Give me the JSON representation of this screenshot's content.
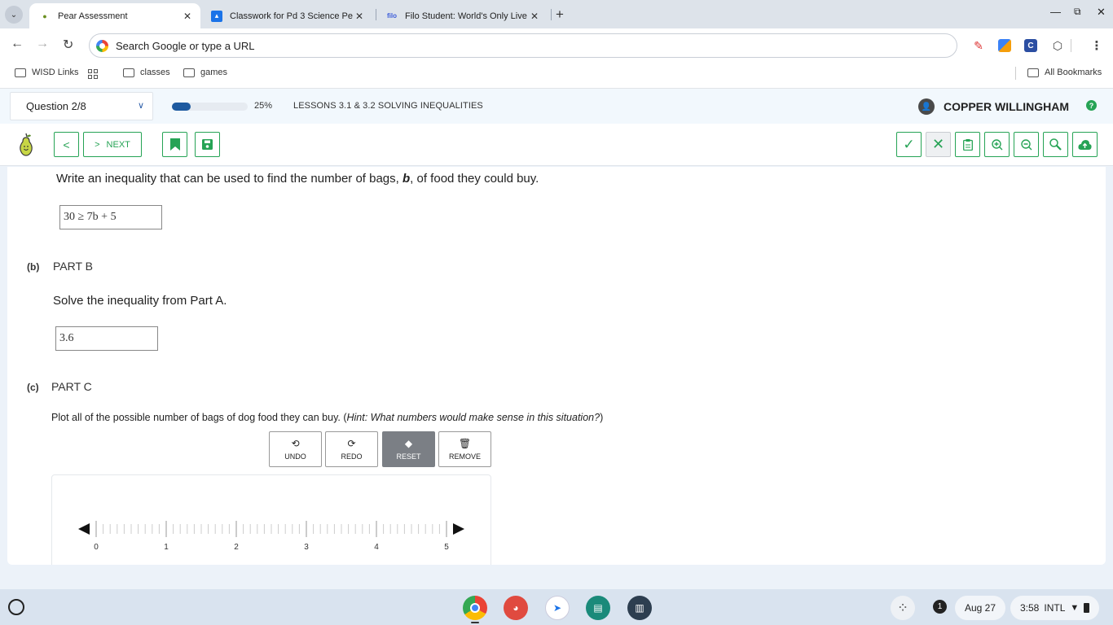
{
  "browser": {
    "tabs": [
      {
        "title": "Pear Assessment",
        "icon": "pear-icon",
        "active": true
      },
      {
        "title": "Classwork for Pd 3 Science Pe",
        "icon": "classroom-icon",
        "active": false
      },
      {
        "title": "Filo Student: World's Only Live",
        "icon": "filo-icon",
        "active": false
      }
    ],
    "omnibox_placeholder": "Search Google or type a URL",
    "bookmarks": [
      "WISD Links",
      "classes",
      "games"
    ],
    "all_bookmarks": "All Bookmarks"
  },
  "app": {
    "question_selector": "Question 2/8",
    "progress_percent": 25,
    "progress_label": "25%",
    "lesson_title": "LESSONS 3.1 & 3.2 SOLVING INEQUALITIES",
    "user_name": "COPPER WILLINGHAM",
    "next_label": "NEXT",
    "accent_color": "#26a355",
    "progress_color": "#1e5aa0"
  },
  "question": {
    "part_a_prompt_pre": "Write an inequality that can be used to find the number of bags, ",
    "part_a_prompt_var": "b",
    "part_a_prompt_post": ", of food they could buy.",
    "part_a_answer": "30 ≥ 7b + 5",
    "part_b": {
      "letter": "(b)",
      "title": "PART B",
      "prompt": "Solve the inequality from Part A.",
      "answer": "3.6"
    },
    "part_c": {
      "letter": "(c)",
      "title": "PART C",
      "prompt": "Plot all of the possible number of bags of dog food they can buy. (",
      "hint": "Hint: What numbers would make sense in this situation?",
      "prompt_end": ")"
    },
    "tools": [
      {
        "label": "UNDO",
        "icon": "undo-icon",
        "active": false
      },
      {
        "label": "REDO",
        "icon": "redo-icon",
        "active": false
      },
      {
        "label": "RESET",
        "icon": "eraser-icon",
        "active": true
      },
      {
        "label": "REMOVE",
        "icon": "trash-icon",
        "active": false
      }
    ],
    "number_line": {
      "min": 0,
      "max": 5,
      "minor_per_unit": 10,
      "labels": [
        "0",
        "1",
        "2",
        "3",
        "4",
        "5"
      ]
    }
  },
  "shelf": {
    "date": "Aug 27",
    "time": "3:58",
    "input_method": "INTL",
    "notification_count": "1"
  }
}
